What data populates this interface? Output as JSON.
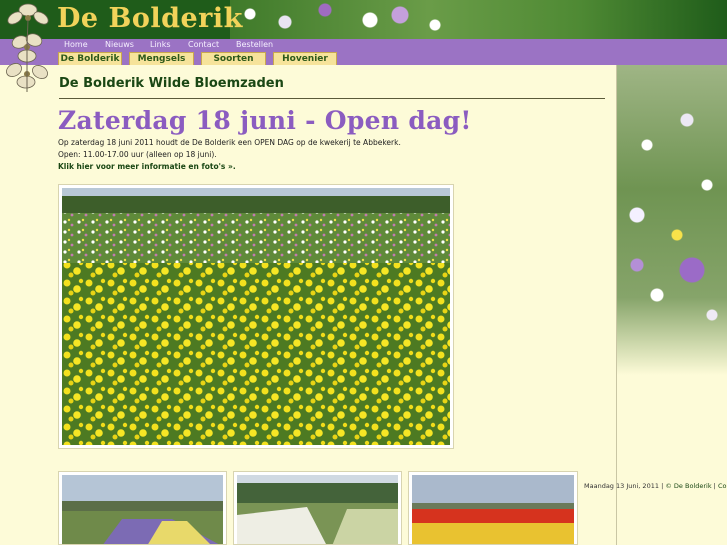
{
  "header": {
    "site_title": "De Bolderik"
  },
  "nav": {
    "links": [
      "Home",
      "Nieuws",
      "Links",
      "Contact",
      "Bestellen"
    ]
  },
  "tabs": [
    {
      "label": "De Bolderik",
      "active": true
    },
    {
      "label": "Mengsels",
      "active": false
    },
    {
      "label": "Soorten",
      "active": false
    },
    {
      "label": "Hovenier",
      "active": false
    }
  ],
  "main": {
    "heading": "De Bolderik Wilde Bloemzaden",
    "headline": "Zaterdag 18 juni - Open dag!",
    "line1": "Op zaterdag 18 juni 2011 houdt de De Bolderik een OPEN DAG op de kwekerij te Abbekerk.",
    "line2": "Open: 11.00-17.00 uur (alleen op 18 juni).",
    "more_link": "Klik hier voor meer informatie en foto's »."
  },
  "footer": {
    "date": "Maandag 13 Juni, 2011",
    "sep1": "|",
    "copyright": "© De Bolderik",
    "sep2": "|",
    "tail": "Co"
  },
  "colors": {
    "header_green": "#1f5c1a",
    "title_gold": "#f2d35a",
    "nav_purple": "#9b73c4",
    "tab_yellow": "#f6e39a",
    "headline_purple": "#8b5cc0",
    "page_bg": "#fdfbd8"
  }
}
